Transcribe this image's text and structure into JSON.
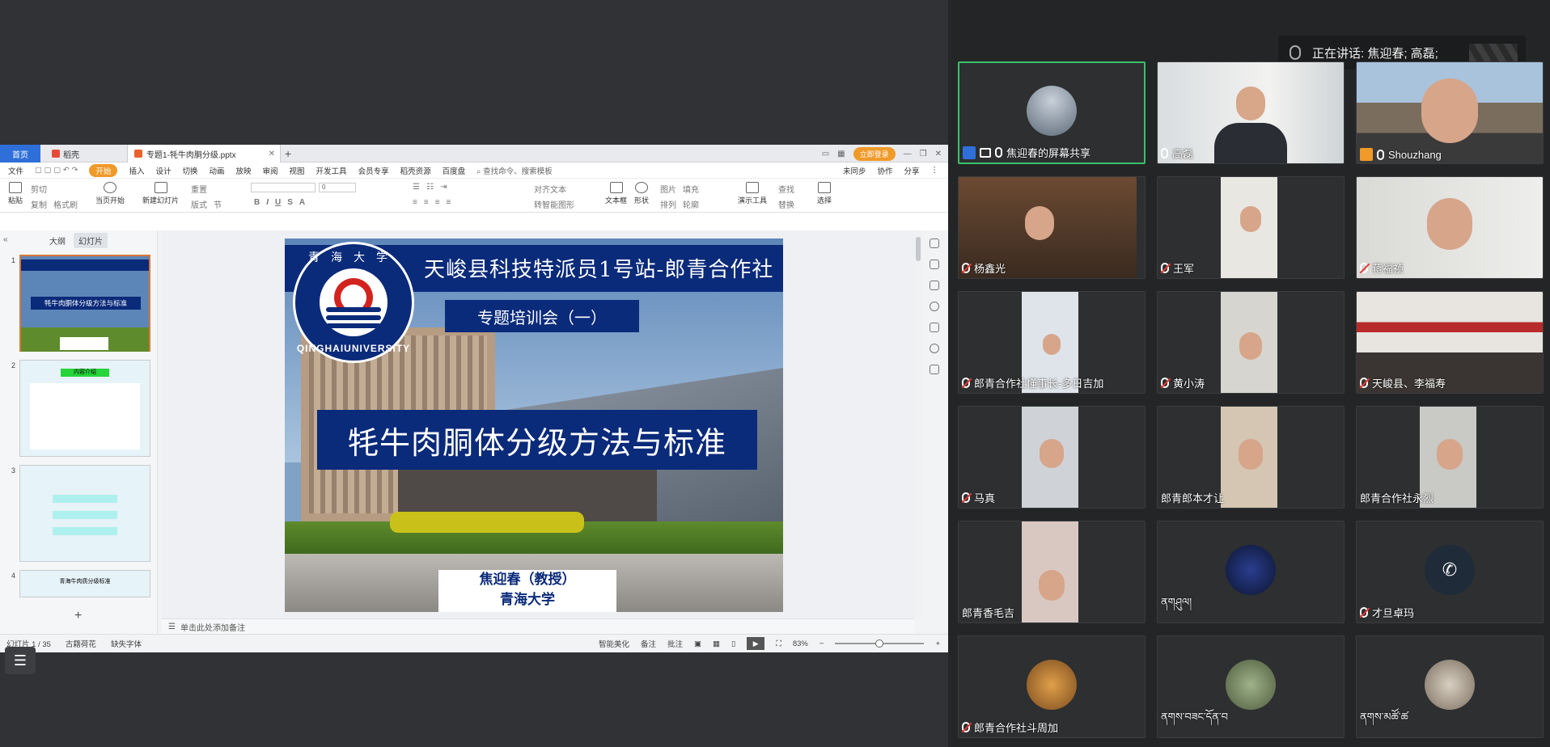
{
  "wps": {
    "tabs": {
      "home": "首页",
      "daoke": "稻壳",
      "file": "专题1-牦牛肉胴分级.pptx",
      "login": "立即登录"
    },
    "menu": [
      "文件",
      "开始",
      "插入",
      "设计",
      "切换",
      "动画",
      "放映",
      "审阅",
      "视图",
      "开发工具",
      "会员专享",
      "稻壳资源",
      "百度盘"
    ],
    "menu_search": "查找命令、搜索模板",
    "menu_right": [
      "未同步",
      "协作",
      "分享"
    ],
    "ribbon": {
      "paste": "粘贴",
      "cut": "剪切",
      "copy": "复制",
      "format_painter": "格式刷",
      "from_current": "当页开始",
      "new_slide": "新建幻灯片",
      "layout": "版式",
      "section": "节",
      "reset": "重置",
      "font_size": "0",
      "textbox": "文本框",
      "shape": "形状",
      "arrange": "排列",
      "picture": "图片",
      "fill": "填充",
      "outline": "轮廓",
      "present_tools": "演示工具",
      "find": "查找",
      "replace": "替换",
      "select": "选择",
      "align_text": "对齐文本",
      "convert_smartart": "转智能图形"
    },
    "panel_tabs": {
      "outline": "大纲",
      "slides": "幻灯片"
    },
    "notes_placeholder": "单击此处添加备注",
    "status": {
      "slide_count": "幻灯片 1 / 35",
      "theme": "古籍荷花",
      "missing_font": "缺失字体",
      "beautify": "智能美化",
      "notes": "备注",
      "comments": "批注",
      "zoom": "83%"
    }
  },
  "slide": {
    "header": "天峻县科技特派员1号站-郎青合作社",
    "subheader": "专题培训会（一）",
    "title": "牦牛肉胴体分级方法与标准",
    "logo_top": "青海大学",
    "logo_bottom": "QINGHAIUNIVERSITY",
    "author_line1": "焦迎春（教授）",
    "author_line2": "青海大学"
  },
  "thumbnails": [
    {
      "num": "1",
      "title": "牦牛肉胴体分级方法与标准"
    },
    {
      "num": "2",
      "title": "内容介绍"
    },
    {
      "num": "3",
      "title": ""
    },
    {
      "num": "4",
      "title": "青海牛肉质分级标准"
    }
  ],
  "meeting": {
    "speaking": "正在讲话: 焦迎春; 高磊;",
    "participants": [
      {
        "name": "焦迎春的屏幕共享"
      },
      {
        "name": "高磊"
      },
      {
        "name": "Shouzhang"
      },
      {
        "name": "杨鑫光"
      },
      {
        "name": "王军"
      },
      {
        "name": "蒋福祯"
      },
      {
        "name": "郎青合作社懂事长-多日吉加"
      },
      {
        "name": "黄小涛"
      },
      {
        "name": "天峻县、李福寿"
      },
      {
        "name": "马真"
      },
      {
        "name": "郎青郎本才让"
      },
      {
        "name": "郎青合作社永烈"
      },
      {
        "name": "郎青香毛吉"
      },
      {
        "name": "ནགཤུལ།"
      },
      {
        "name": "才旦卓玛"
      },
      {
        "name": "郎青合作社斗周加"
      },
      {
        "name": "ནགས་བཟང་དོན་བ"
      },
      {
        "name": "ནགས་མཚོ་ཚ"
      }
    ]
  },
  "colors": {
    "accent_blue": "#0a2a7a",
    "wps_home_blue": "#2f6fd9",
    "wps_orange": "#f09a2a",
    "active_speaker_green": "#39c16c"
  }
}
